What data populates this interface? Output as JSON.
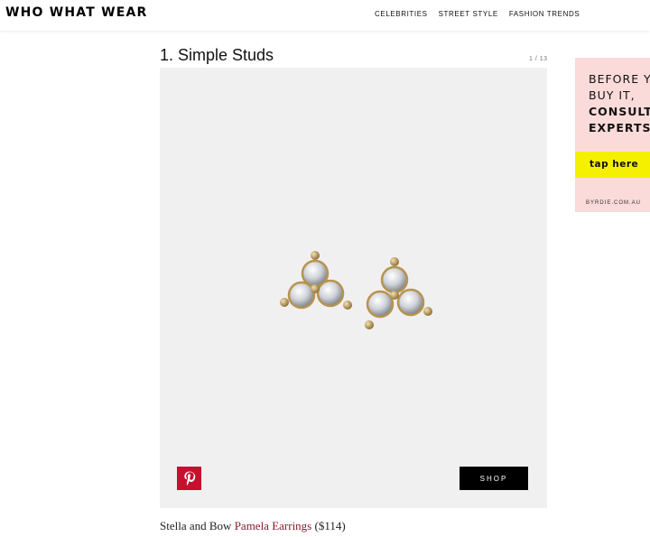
{
  "header": {
    "logo": "WHO WHAT WEAR",
    "nav": [
      "CELEBRITIES",
      "STREET STYLE",
      "FASHION TRENDS"
    ]
  },
  "gallery": {
    "title": "1. Simple Studs",
    "counter": "1 / 13",
    "shop_label": "SHOP",
    "pinterest_icon": "pinterest-icon"
  },
  "caption": {
    "brand": "Stella and Bow",
    "product": "Pamela Earrings",
    "price": "($114)"
  },
  "ad": {
    "line1": "BEFORE YOU BUY IT,",
    "line1a": "BEFORE YOU",
    "line1b": "BUY IT,",
    "line2a": "CONSULT",
    "line2b": "EXPERTS.",
    "cta": "tap here",
    "domain": "BYRDIE.COM.AU"
  },
  "colors": {
    "accent_link": "#8b1a2b",
    "pinterest_red": "#c8102e",
    "ad_bg": "#fbdada",
    "ad_cta": "#f5f000"
  }
}
